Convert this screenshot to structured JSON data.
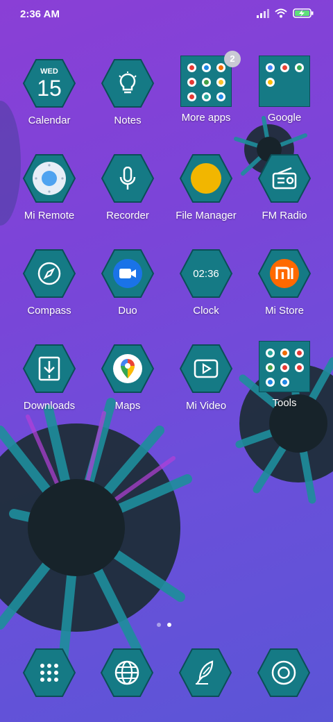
{
  "status_bar": {
    "time": "2:36 AM"
  },
  "colors": {
    "hex_fill": "#157a85",
    "hex_edge": "#0b4e57",
    "accent_yellow": "#f2b600"
  },
  "apps": {
    "calendar": {
      "label": "Calendar",
      "day": "WED",
      "date": "15"
    },
    "notes": {
      "label": "Notes"
    },
    "more_apps": {
      "label": "More apps",
      "badge": "2"
    },
    "google": {
      "label": "Google"
    },
    "mi_remote": {
      "label": "Mi Remote"
    },
    "recorder": {
      "label": "Recorder"
    },
    "file_manager": {
      "label": "File Manager"
    },
    "fm_radio": {
      "label": "FM Radio"
    },
    "compass": {
      "label": "Compass"
    },
    "duo": {
      "label": "Duo"
    },
    "clock": {
      "label": "Clock",
      "time": "02:36"
    },
    "mi_store": {
      "label": "Mi Store",
      "logo": "mi"
    },
    "downloads": {
      "label": "Downloads"
    },
    "maps": {
      "label": "Maps"
    },
    "mi_video": {
      "label": "Mi Video"
    },
    "tools": {
      "label": "Tools"
    }
  },
  "dock": [
    "app-drawer-icon",
    "browser-globe-icon",
    "feather-notes-icon",
    "camera-icon"
  ],
  "pages": {
    "count": 2,
    "current": 2
  }
}
